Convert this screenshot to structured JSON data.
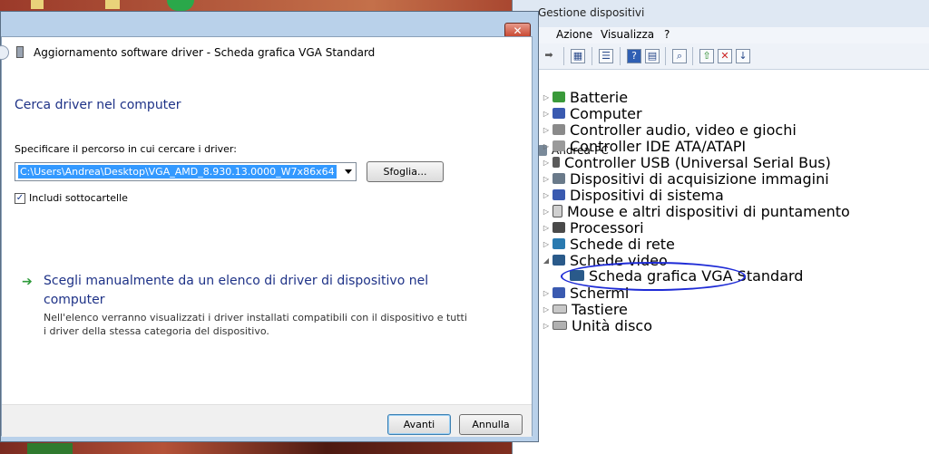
{
  "dialog": {
    "title": "Aggiornamento software driver - Scheda grafica VGA Standard",
    "close_glyph": "✕",
    "heading": "Cerca driver nel computer",
    "path_label": "Specificare il percorso in cui cercare i driver:",
    "path_value": "C:\\Users\\Andrea\\Desktop\\VGA_AMD_8.930.13.0000_W7x86x64",
    "browse_label": "Sfoglia...",
    "include_subfolders_label": "Includi sottocartelle",
    "include_subfolders_checked": "✓",
    "manual_title": "Scegli manualmente da un elenco di driver di dispositivo nel computer",
    "manual_desc": "Nell'elenco verranno visualizzati i driver installati compatibili con il dispositivo e tutti i driver della stessa categoria del dispositivo.",
    "next_label": "Avanti",
    "cancel_label": "Annulla"
  },
  "device_manager": {
    "title": "Gestione dispositivi",
    "menu": [
      "Azione",
      "Visualizza",
      "?"
    ],
    "root": "Andrea-PC",
    "items": [
      {
        "label": "Batterie",
        "icon": "battery-icon"
      },
      {
        "label": "Computer",
        "icon": "computer-icon"
      },
      {
        "label": "Controller audio, video e giochi",
        "icon": "speaker-icon"
      },
      {
        "label": "Controller IDE ATA/ATAPI",
        "icon": "ide-icon"
      },
      {
        "label": "Controller USB (Universal Serial Bus)",
        "icon": "usb-icon"
      },
      {
        "label": "Dispositivi di acquisizione immagini",
        "icon": "scanner-icon"
      },
      {
        "label": "Dispositivi di sistema",
        "icon": "system-icon"
      },
      {
        "label": "Mouse e altri dispositivi di puntamento",
        "icon": "mouse-icon"
      },
      {
        "label": "Processori",
        "icon": "cpu-icon"
      },
      {
        "label": "Schede di rete",
        "icon": "network-icon"
      },
      {
        "label": "Schede video",
        "icon": "display-adapter-icon"
      },
      {
        "label": "Scheda grafica VGA Standard",
        "icon": "display-adapter-icon"
      },
      {
        "label": "Schermi",
        "icon": "monitor-icon"
      },
      {
        "label": "Tastiere",
        "icon": "keyboard-icon"
      },
      {
        "label": "Unità disco",
        "icon": "disk-icon"
      }
    ]
  },
  "colors": {
    "heading_blue": "#1e3287",
    "selection_blue": "#3399ff",
    "annotation_ellipse": "#1e2bd6"
  }
}
